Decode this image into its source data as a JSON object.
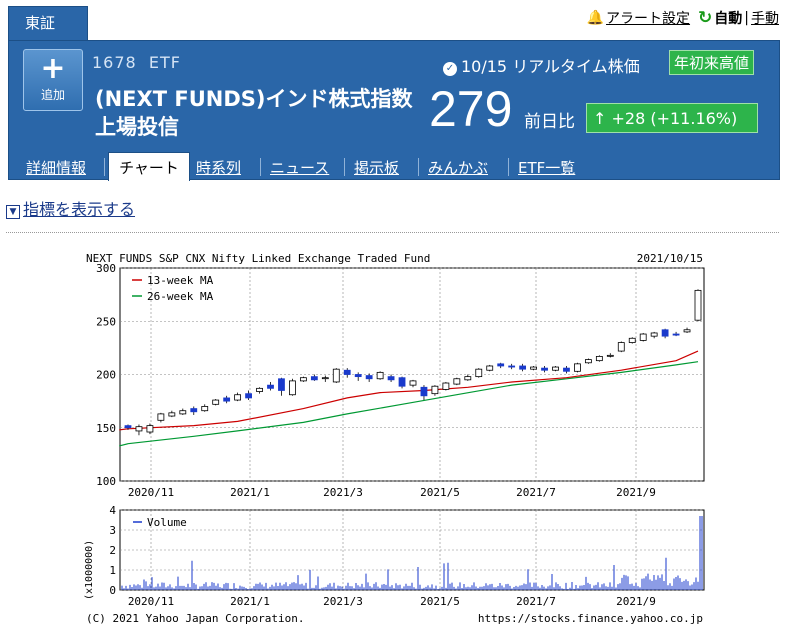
{
  "exchange_tab": "東証",
  "top_links": {
    "alert": "アラート設定",
    "auto": "自動",
    "separator": "|",
    "manual": "手動"
  },
  "add_button": {
    "icon": "plus-icon",
    "label": "追加"
  },
  "stock": {
    "code": "1678",
    "type": "ETF",
    "name": "(NEXT FUNDS)インド株式指数上場投信",
    "realtime_label": "10/15 リアルタイム株価",
    "high_badge": "年初来高値",
    "price": "279",
    "prev_label": "前日比",
    "change": "+28 (+11.16%)"
  },
  "nav_tabs": [
    "詳細情報",
    "チャート",
    "時系列",
    "ニュース",
    "掲示板",
    "みんかぶ",
    "ETF一覧"
  ],
  "active_tab": "チャート",
  "indicator_toggle": "指標を表示する",
  "chart_data": {
    "type": "candlestick",
    "title": "NEXT FUNDS S&P CNX Nifty Linked Exchange Traded Fund",
    "date": "2021/10/15",
    "ylim": [
      100,
      300
    ],
    "yticks": [
      "300",
      "250",
      "200",
      "150",
      "100"
    ],
    "xticks": [
      "2020/11",
      "2021/1",
      "2021/3",
      "2021/5",
      "2021/7",
      "2021/9"
    ],
    "legend": [
      "13-week MA",
      "26-week MA"
    ],
    "candles": [
      [
        152,
        150,
        153,
        148
      ],
      [
        147,
        151,
        153,
        143
      ],
      [
        146,
        152,
        154,
        144
      ],
      [
        157,
        163,
        164,
        155
      ],
      [
        161,
        164,
        166,
        160
      ],
      [
        163,
        166,
        168,
        162
      ],
      [
        168,
        165,
        170,
        162
      ],
      [
        166,
        170,
        172,
        165
      ],
      [
        172,
        176,
        177,
        171
      ],
      [
        178,
        175,
        180,
        173
      ],
      [
        176,
        181,
        183,
        175
      ],
      [
        182,
        178,
        185,
        176
      ],
      [
        184,
        187,
        188,
        182
      ],
      [
        190,
        187,
        193,
        185
      ],
      [
        196,
        185,
        197,
        180
      ],
      [
        181,
        194,
        196,
        180
      ],
      [
        194,
        197,
        198,
        193
      ],
      [
        198,
        195,
        200,
        194
      ],
      [
        197,
        197,
        199,
        193
      ],
      [
        193,
        205,
        206,
        192
      ],
      [
        204,
        200,
        206,
        197
      ],
      [
        200,
        198,
        202,
        194
      ],
      [
        199,
        196,
        201,
        193
      ],
      [
        196,
        202,
        203,
        195
      ],
      [
        198,
        195,
        200,
        193
      ],
      [
        197,
        189,
        198,
        187
      ],
      [
        190,
        194,
        195,
        188
      ],
      [
        188,
        180,
        190,
        176
      ],
      [
        182,
        189,
        190,
        180
      ],
      [
        186,
        192,
        193,
        185
      ],
      [
        191,
        196,
        197,
        190
      ],
      [
        195,
        198,
        200,
        194
      ],
      [
        198,
        205,
        206,
        197
      ],
      [
        204,
        208,
        209,
        203
      ],
      [
        210,
        208,
        211,
        206
      ],
      [
        208,
        207,
        210,
        205
      ],
      [
        208,
        205,
        210,
        203
      ],
      [
        205,
        207,
        208,
        204
      ],
      [
        206,
        204,
        208,
        202
      ],
      [
        204,
        207,
        208,
        203
      ],
      [
        206,
        203,
        208,
        201
      ],
      [
        203,
        210,
        211,
        202
      ],
      [
        211,
        214,
        215,
        210
      ],
      [
        213,
        217,
        218,
        212
      ],
      [
        218,
        218,
        220,
        216
      ],
      [
        222,
        230,
        231,
        221
      ],
      [
        230,
        234,
        235,
        229
      ],
      [
        232,
        238,
        239,
        231
      ],
      [
        236,
        239,
        240,
        234
      ],
      [
        242,
        236,
        243,
        234
      ],
      [
        238,
        237,
        240,
        236
      ],
      [
        240,
        242,
        244,
        239
      ],
      [
        251,
        279,
        280,
        250
      ]
    ],
    "ma13": [
      [
        0,
        149
      ],
      [
        6,
        152
      ],
      [
        10,
        156
      ],
      [
        16,
        168
      ],
      [
        20,
        178
      ],
      [
        23,
        183
      ],
      [
        27,
        185
      ],
      [
        31,
        188
      ],
      [
        35,
        193
      ],
      [
        40,
        197
      ],
      [
        45,
        204
      ],
      [
        50,
        213
      ],
      [
        52,
        222
      ]
    ],
    "ma26": [
      [
        0,
        135
      ],
      [
        6,
        142
      ],
      [
        10,
        147
      ],
      [
        16,
        155
      ],
      [
        20,
        163
      ],
      [
        25,
        172
      ],
      [
        30,
        181
      ],
      [
        35,
        190
      ],
      [
        40,
        196
      ],
      [
        45,
        202
      ],
      [
        50,
        209
      ],
      [
        52,
        212
      ]
    ],
    "volume": {
      "label": "Volume",
      "ylabel": "(x1000000)",
      "ylim": [
        0,
        4
      ],
      "yticks": [
        "4",
        "3",
        "2",
        "1",
        "0"
      ]
    },
    "footer_left": "(C) 2021 Yahoo Japan Corporation.",
    "footer_right": "https://stocks.finance.yahoo.co.jp"
  },
  "colors": {
    "accent": "#2a66a8",
    "badge_green": "#2db44b",
    "ma13": "#cc0000",
    "ma26": "#009933",
    "candle_down": "#1a3acc",
    "volume": "#1a3acc"
  }
}
